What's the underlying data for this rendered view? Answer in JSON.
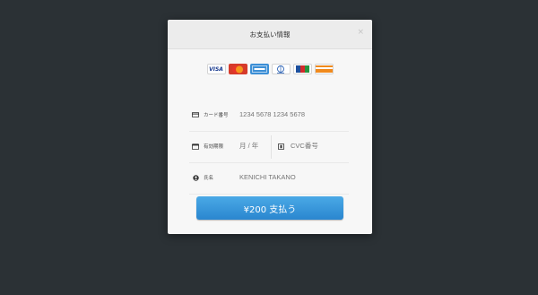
{
  "dialog": {
    "title": "お支払い情報",
    "close_label": "×"
  },
  "card_brands": [
    {
      "name": "VISA",
      "icon": "visa-icon"
    },
    {
      "name": "MasterCard",
      "icon": "mastercard-icon"
    },
    {
      "name": "AMEX",
      "icon": "amex-icon"
    },
    {
      "name": "Diners Club",
      "icon": "diners-icon"
    },
    {
      "name": "JCB",
      "icon": "jcb-icon"
    },
    {
      "name": "DISCOVER",
      "icon": "discover-icon"
    }
  ],
  "form": {
    "card_number": {
      "label": "カード番号",
      "placeholder": "1234 5678 1234 5678",
      "icon": "credit-card-icon"
    },
    "expiry": {
      "label": "有効期限",
      "placeholder": "月 / 年",
      "icon": "calendar-icon"
    },
    "cvc": {
      "placeholder": "CVC番号",
      "icon": "lock-icon"
    },
    "name": {
      "label": "氏名",
      "placeholder": "KENICHI TAKANO",
      "icon": "person-icon"
    }
  },
  "pay_button": {
    "label": "¥200 支払う"
  },
  "colors": {
    "accent": "#3498db",
    "backdrop": "#2b3135"
  }
}
